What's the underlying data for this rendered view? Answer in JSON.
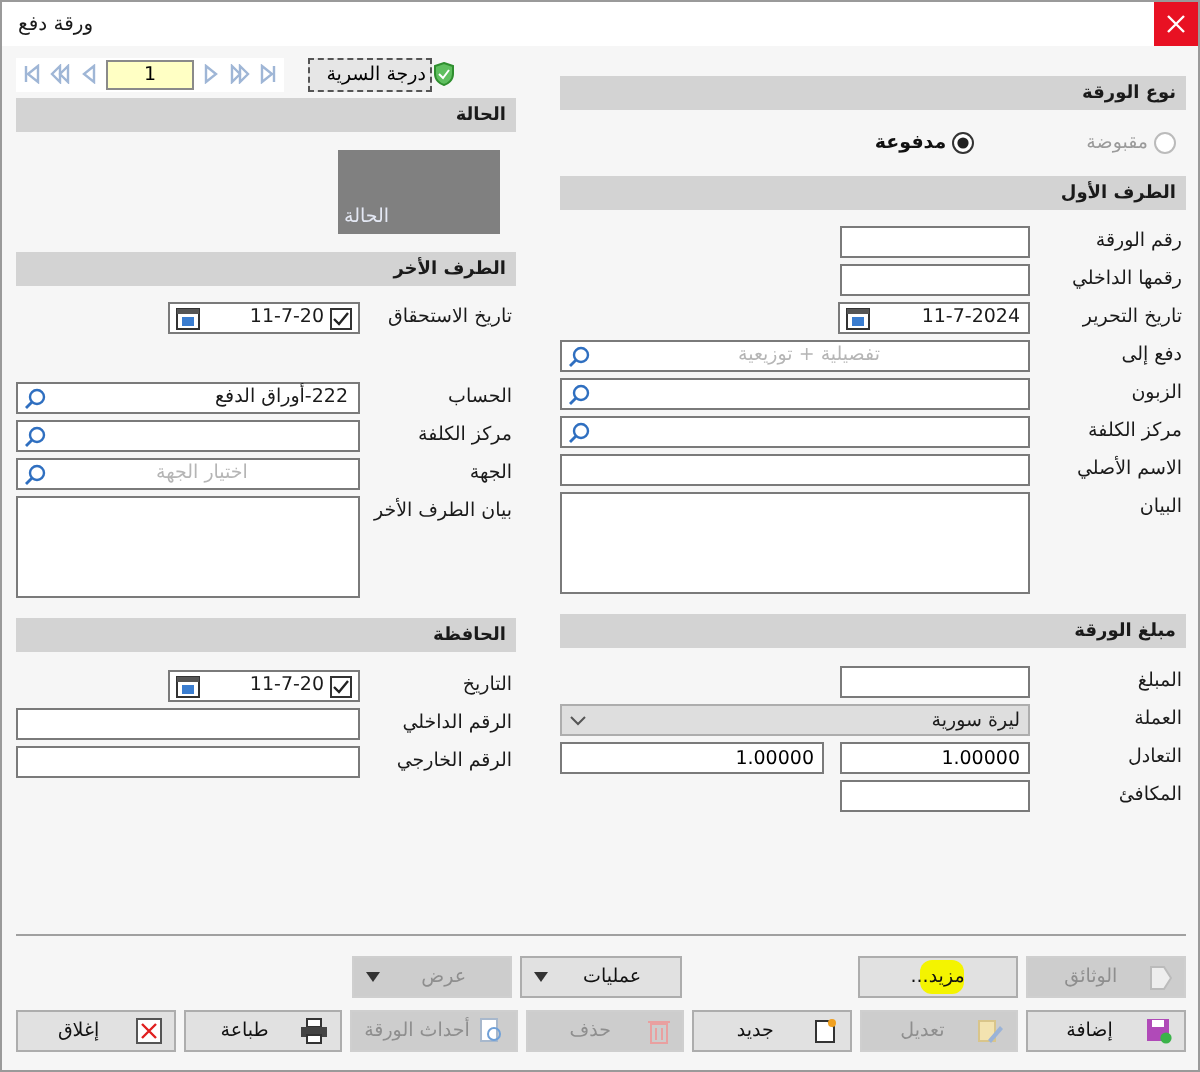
{
  "window": {
    "title": "ورقة دفع"
  },
  "navigator": {
    "page": "1"
  },
  "secrecy_button": {
    "label": "درجة السرية"
  },
  "status": {
    "header": "الحالة",
    "tile": "الحالة"
  },
  "other_party": {
    "header": "الطرف الأخر",
    "date_fields": [
      {
        "kind": "checked_date",
        "label": "تاريخ الاستحقاق",
        "value": "11-7-20",
        "checked": true
      }
    ],
    "fields": [
      {
        "kind": "search",
        "label": "الحساب",
        "value": "222-أوراق الدفع"
      },
      {
        "kind": "search",
        "label": "مركز الكلفة"
      },
      {
        "kind": "search",
        "label": "الجهة",
        "placeholder": "اختيار الجهة"
      },
      {
        "kind": "textarea",
        "label": "بيان الطرف الأخر"
      }
    ]
  },
  "wallet": {
    "header": "الحافظة",
    "fields": [
      {
        "kind": "checked_date",
        "label": "التاريخ",
        "value": "11-7-20",
        "checked": true
      },
      {
        "kind": "text",
        "label": "الرقم الداخلي"
      },
      {
        "kind": "text",
        "label": "الرقم الخارجي"
      }
    ]
  },
  "paper_type": {
    "header": "نوع الورقة",
    "options": [
      {
        "label": "مقبوضة",
        "selected": false,
        "disabled": true
      },
      {
        "label": "مدفوعة",
        "selected": true,
        "disabled": false
      }
    ]
  },
  "first_party": {
    "header": "الطرف الأول",
    "fields": [
      {
        "kind": "short",
        "label": "رقم الورقة"
      },
      {
        "kind": "short",
        "label": "رقمها الداخلي"
      },
      {
        "kind": "date",
        "label": "تاريخ التحرير",
        "value": "11-7-2024"
      },
      {
        "kind": "search",
        "label": "دفع إلى",
        "placeholder": "تفصيلية + توزيعية"
      },
      {
        "kind": "search",
        "label": "الزبون"
      },
      {
        "kind": "search",
        "label": "مركز الكلفة"
      },
      {
        "kind": "text",
        "label": "الاسم الأصلي"
      },
      {
        "kind": "textarea",
        "label": "البيان"
      }
    ]
  },
  "amount": {
    "header": "مبلغ الورقة",
    "fields": [
      {
        "kind": "short",
        "label": "المبلغ"
      },
      {
        "kind": "select",
        "label": "العملة",
        "value": "ليرة سورية"
      },
      {
        "kind": "pair",
        "label": "التعادل",
        "value": "1.00000",
        "value_2": "1.00000"
      },
      {
        "kind": "short",
        "label": "المكافئ"
      }
    ]
  },
  "footer": {
    "row1": [
      {
        "kind": "button",
        "label": "الوثائق",
        "disabled": true,
        "highlighted": false
      },
      {
        "kind": "button",
        "label": "مزيد...",
        "disabled": false,
        "highlighted": true
      },
      {
        "kind": "dropdown",
        "label": "عمليات",
        "disabled": false,
        "highlighted": false
      },
      {
        "kind": "dropdown",
        "label": "عرض",
        "disabled": true,
        "highlighted": false
      }
    ],
    "row2": [
      {
        "label": "إضافة",
        "disabled": false
      },
      {
        "label": "تعديل",
        "disabled": true
      },
      {
        "label": "جديد",
        "disabled": false
      },
      {
        "label": "حذف",
        "disabled": true
      },
      {
        "label": "أحداث الورقة",
        "disabled": true
      },
      {
        "label": "طباعة",
        "disabled": false
      },
      {
        "label": "إغلاق",
        "disabled": false
      }
    ]
  }
}
